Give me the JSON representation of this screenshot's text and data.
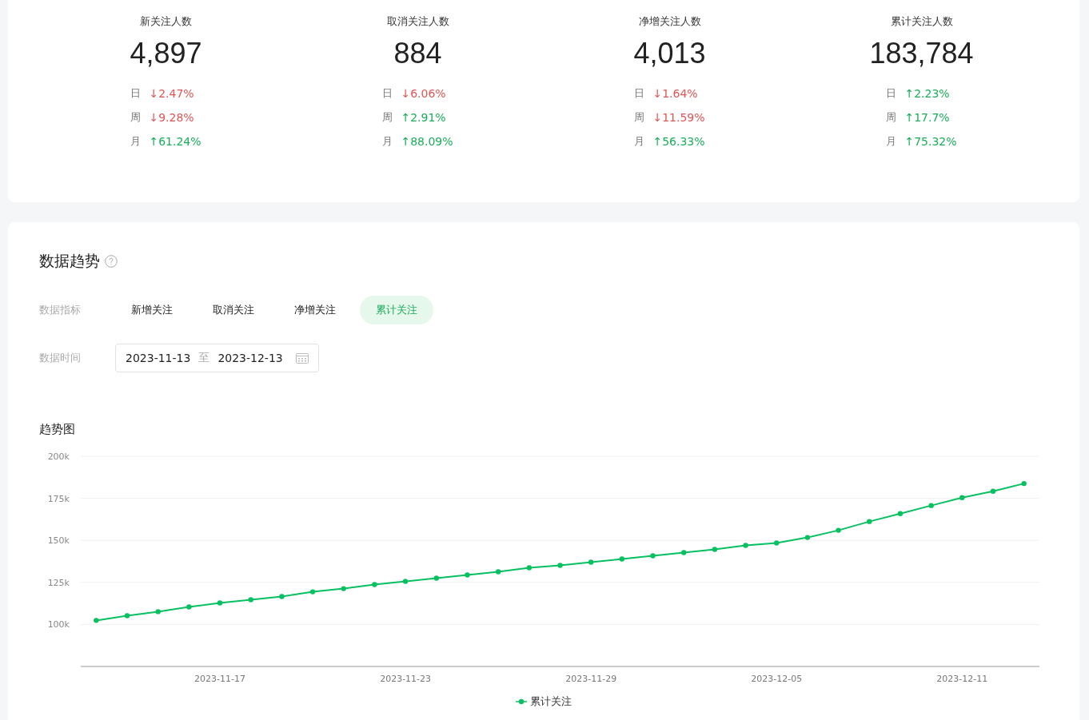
{
  "stats": [
    {
      "title": "新关注人数",
      "value": "4,897",
      "changes": [
        {
          "period": "日",
          "value": "↓2.47%",
          "color": "#e05555"
        },
        {
          "period": "周",
          "value": "↓9.28%",
          "color": "#e05555"
        },
        {
          "period": "月",
          "value": "↑61.24%",
          "color": "#1aad5a"
        }
      ]
    },
    {
      "title": "取消关注人数",
      "value": "884",
      "changes": [
        {
          "period": "日",
          "value": "↓6.06%",
          "color": "#e05555"
        },
        {
          "period": "周",
          "value": "↑2.91%",
          "color": "#1aad5a"
        },
        {
          "period": "月",
          "value": "↑88.09%",
          "color": "#1aad5a"
        }
      ]
    },
    {
      "title": "净增关注人数",
      "value": "4,013",
      "changes": [
        {
          "period": "日",
          "value": "↓1.64%",
          "color": "#e05555"
        },
        {
          "period": "周",
          "value": "↓11.59%",
          "color": "#e05555"
        },
        {
          "period": "月",
          "value": "↑56.33%",
          "color": "#1aad5a"
        }
      ]
    },
    {
      "title": "累计关注人数",
      "value": "183,784",
      "changes": [
        {
          "period": "日",
          "value": "↑2.23%",
          "color": "#1aad5a"
        },
        {
          "period": "周",
          "value": "↑17.7%",
          "color": "#1aad5a"
        },
        {
          "period": "月",
          "value": "↑75.32%",
          "color": "#1aad5a"
        }
      ]
    }
  ],
  "trend": {
    "title": "数据趋势",
    "metric_label": "数据指标",
    "metrics": [
      {
        "label": "新增关注",
        "selected": false
      },
      {
        "label": "取消关注",
        "selected": false
      },
      {
        "label": "净增关注",
        "selected": false
      },
      {
        "label": "累计关注",
        "selected": true
      }
    ],
    "time_label": "数据时间",
    "date_range": {
      "start": "2023-11-13",
      "separator": "至",
      "end": "2023-12-13"
    },
    "chart_title": "趋势图",
    "chart_data": {
      "type": "line",
      "grid": true,
      "categories": [
        null,
        null,
        null,
        null,
        "2023-11-17",
        null,
        null,
        null,
        null,
        null,
        "2023-11-23",
        null,
        null,
        null,
        null,
        null,
        "2023-11-29",
        null,
        null,
        null,
        null,
        null,
        "2023-12-05",
        null,
        null,
        null,
        null,
        null,
        "2023-12-11",
        null,
        null
      ],
      "series": [
        {
          "name": "累计关注",
          "color": "#07c160",
          "marker": true,
          "values": [
            102400,
            105200,
            107600,
            110400,
            112800,
            114700,
            116600,
            119400,
            121300,
            123700,
            125600,
            127500,
            129400,
            131300,
            133700,
            135100,
            137000,
            138900,
            140800,
            142700,
            144600,
            147000,
            148400,
            151700,
            156000,
            161200,
            165900,
            170700,
            175400,
            179200,
            183800
          ]
        }
      ],
      "ylim": [
        75000,
        200000
      ],
      "yticks": [
        {
          "value": 100000,
          "label": "100k"
        },
        {
          "value": 125000,
          "label": "125k"
        },
        {
          "value": 150000,
          "label": "150k"
        },
        {
          "value": 175000,
          "label": "175k"
        },
        {
          "value": 200000,
          "label": "200k"
        }
      ]
    }
  }
}
